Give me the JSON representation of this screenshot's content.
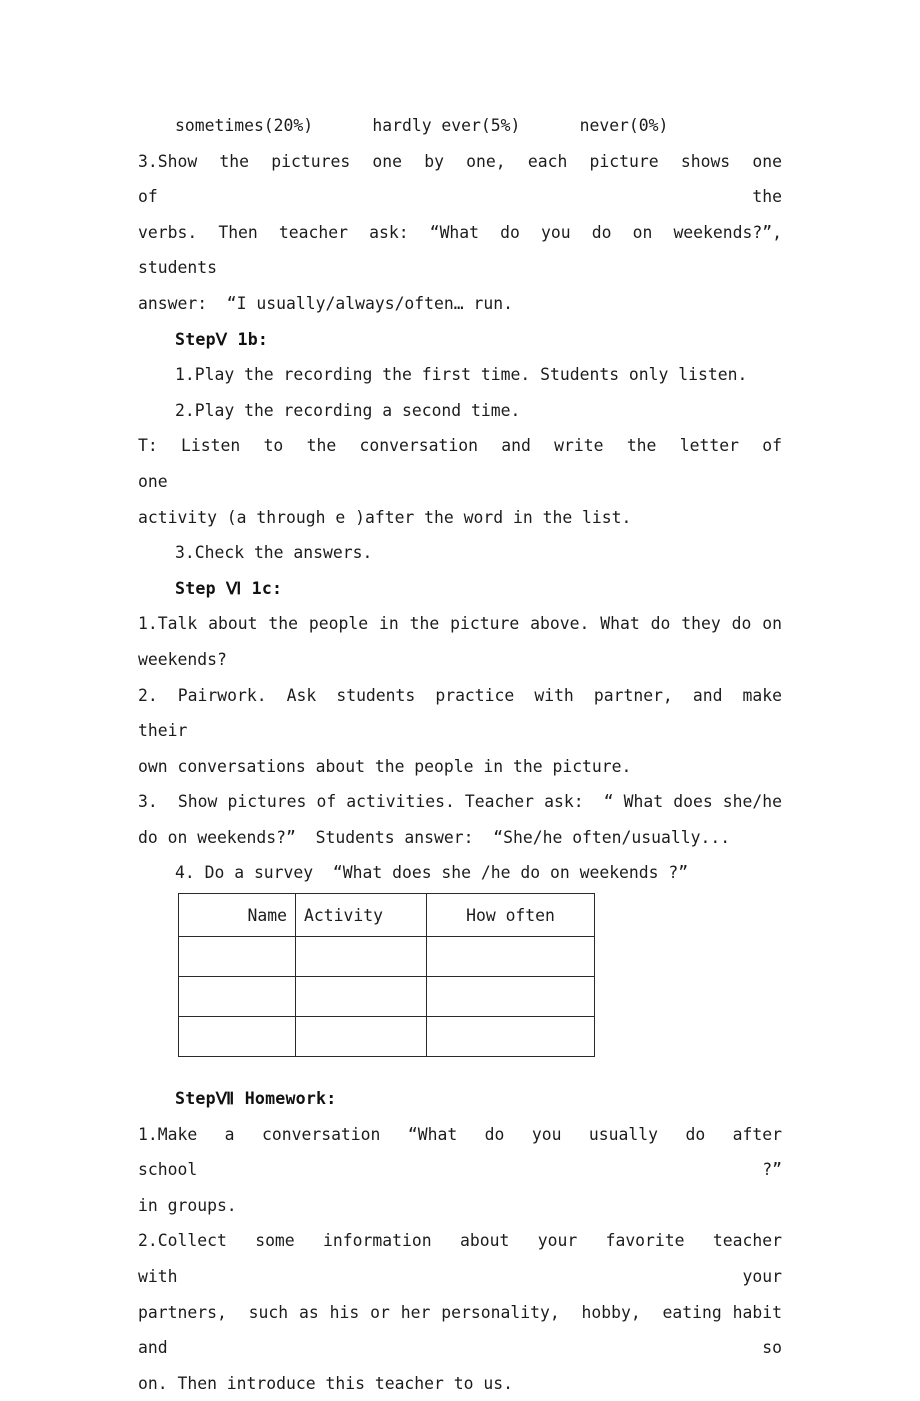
{
  "document": {
    "type": "lesson-plan",
    "page_background": "#ffffff",
    "text_color": "#1c1c1c"
  },
  "frequency_line": {
    "items": [
      {
        "label": "sometimes",
        "percent": "(20%)"
      },
      {
        "label": "hardly ever",
        "percent": "(5%)"
      },
      {
        "label": "never",
        "percent": "(0%)"
      }
    ],
    "text": "sometimes(20%)      hardly ever(5%)      never(0%)"
  },
  "para_show_pictures": {
    "line1": "3.Show  the  pictures  one  by  one,  each  picture  shows  one  of  the",
    "line2": "verbs.  Then  teacher  ask:  “What  do  you  do  on  weekends?”,  students",
    "line3": "answer:  “I usually/always/often… run."
  },
  "step_v": {
    "heading": "StepⅤ 1b:",
    "items": [
      "1.Play the recording the first time. Students only listen.",
      "2.Play the recording a second time."
    ],
    "teacher_line1": "T:  Listen  to  the  conversation  and  write  the  letter  of  one",
    "teacher_line2": "activity (a through e )after the word in the list.",
    "item3": "3.Check the answers."
  },
  "step_vi": {
    "heading": "Step Ⅵ 1c:",
    "item1_line1": "1.Talk about the people in the picture above. What do they do on",
    "item1_line2": "weekends?",
    "item2_line1": "2.  Pairwork.  Ask  students  practice  with  partner,  and  make  their",
    "item2_line2": "own conversations about the people in the picture.",
    "item3_line1": "3.  Show pictures of activities. Teacher ask:  “ What does she/he",
    "item3_line2": "do on weekends?”  Students answer:  “She/he often/usually...",
    "item4": "4. Do a survey  “What does she /he do on weekends ?”"
  },
  "survey_table": {
    "columns": [
      "Name",
      "Activity",
      "How often"
    ],
    "rows": [
      [
        "",
        "",
        ""
      ],
      [
        "",
        "",
        ""
      ],
      [
        "",
        "",
        ""
      ]
    ],
    "border_color": "#2a2a2a"
  },
  "step_vii": {
    "heading": "StepⅦ Homework:",
    "item1_line1": "1.Make  a  conversation  “What  do  you  usually  do  after  school  ?”",
    "item1_line2": "in groups.",
    "item2_line1": "2.Collect  some  information  about  your  favorite  teacher  with  your",
    "item2_line2": "partners,  such as his or her personality,  hobby,  eating habit and so",
    "item2_line3": "on. Then introduce this teacher to us."
  }
}
